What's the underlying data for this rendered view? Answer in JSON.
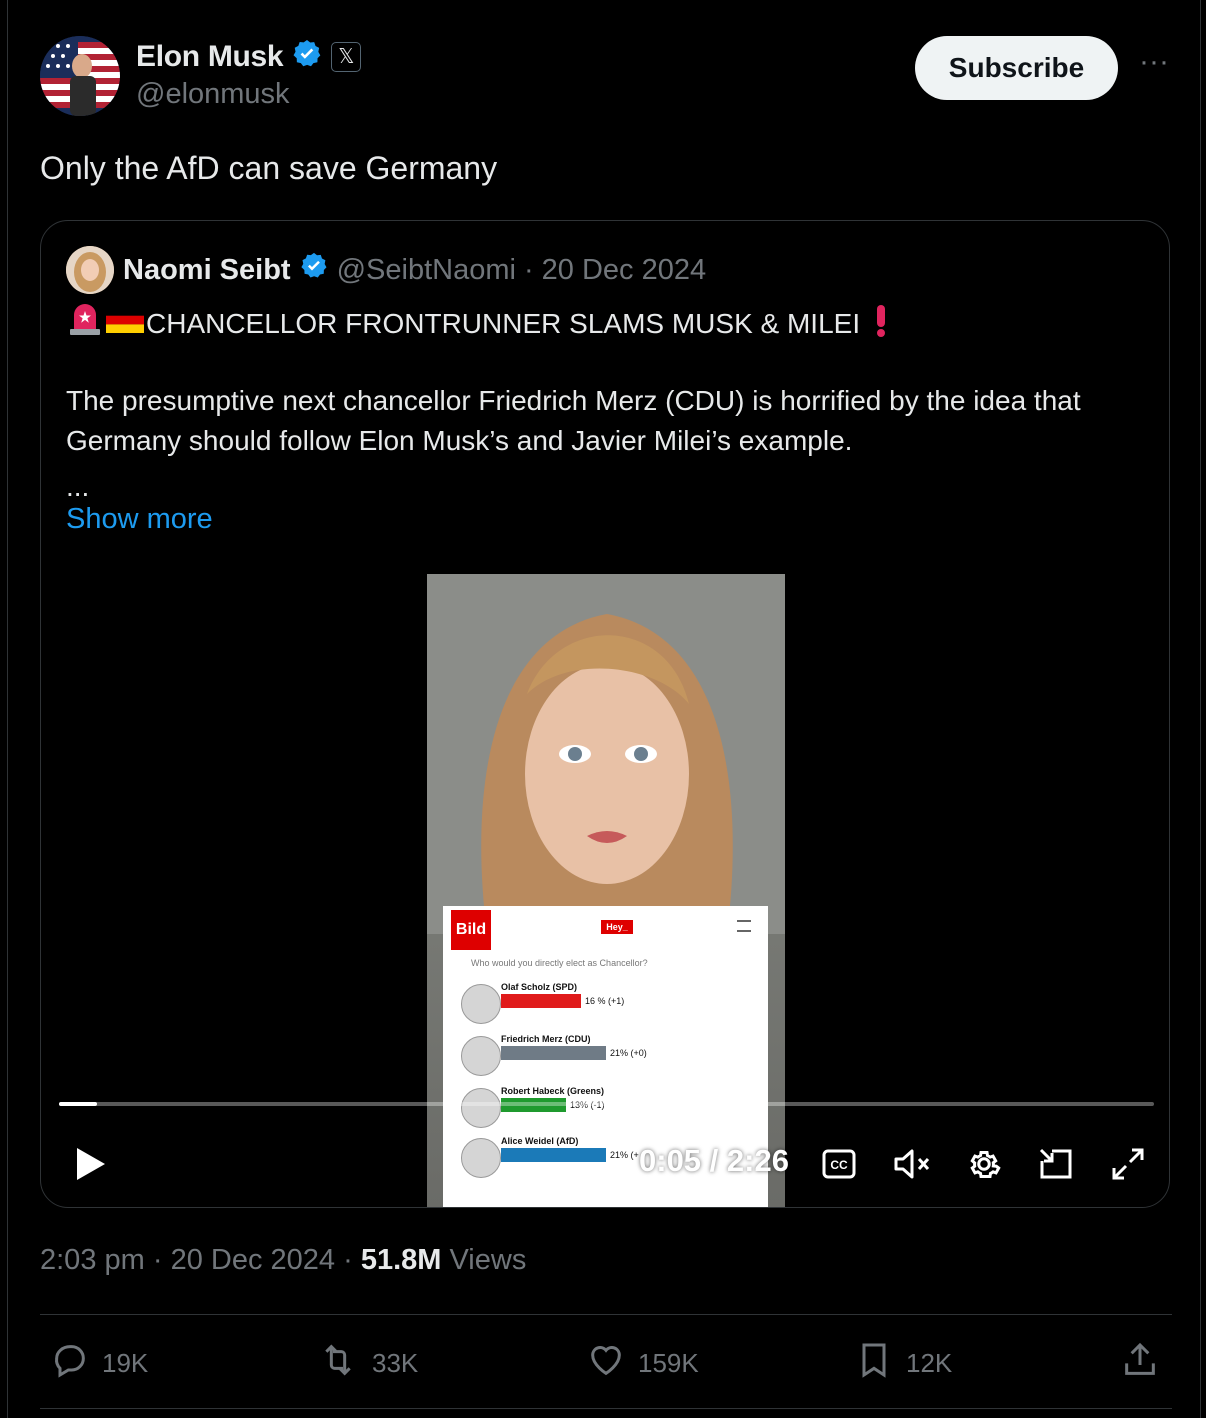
{
  "author": {
    "name": "Elon Musk",
    "handle": "@elonmusk",
    "badge": "𝕏"
  },
  "header": {
    "subscribe_label": "Subscribe",
    "more_label": "···"
  },
  "tweet": {
    "text": "Only the AfD can save Germany"
  },
  "quote": {
    "name": "Naomi Seibt",
    "handle": "@SeibtNaomi",
    "date": "· 20 Dec 2024",
    "headline": "CHANCELLOR FRONTRUNNER SLAMS MUSK & MILEI",
    "body": "The presumptive next chancellor Friedrich Merz (CDU) is horrified by the idea that Germany should follow Elon Musk’s and Javier Milei’s example.",
    "ellipsis": "...",
    "show_more": "Show more",
    "video": {
      "bild_logo": "Bild",
      "bild_hey": "Hey_",
      "bild_question": "Who would you directly elect as Chancellor?",
      "poll": [
        {
          "name": "Olaf Scholz (SPD)",
          "value_label": "16 %  (+1)",
          "value": 16,
          "color": "#e01b1b"
        },
        {
          "name": "Friedrich Merz (CDU)",
          "value_label": "21%  (+0)",
          "value": 21,
          "color": "#6f7b86"
        },
        {
          "name": "Robert Habeck (Greens)",
          "value_label": "13%  (-1)",
          "value": 13,
          "color": "#1f9a2e"
        },
        {
          "name": "Alice Weidel (AfD)",
          "value_label": "21%  (+",
          "value": 21,
          "color": "#1b7ab8"
        }
      ],
      "time": "0:05 / 2:26",
      "progress": 0.035
    }
  },
  "meta": {
    "time": "2:03 pm",
    "date": "· 20 Dec 2024 ·",
    "views_count": "51.8M",
    "views_label": "Views"
  },
  "actions": {
    "replies": "19K",
    "reposts": "33K",
    "likes": "159K",
    "bookmarks": "12K"
  },
  "colors": {
    "accent": "#1d9bf0",
    "verified": "#1d9bf0",
    "muted": "#71767b"
  }
}
